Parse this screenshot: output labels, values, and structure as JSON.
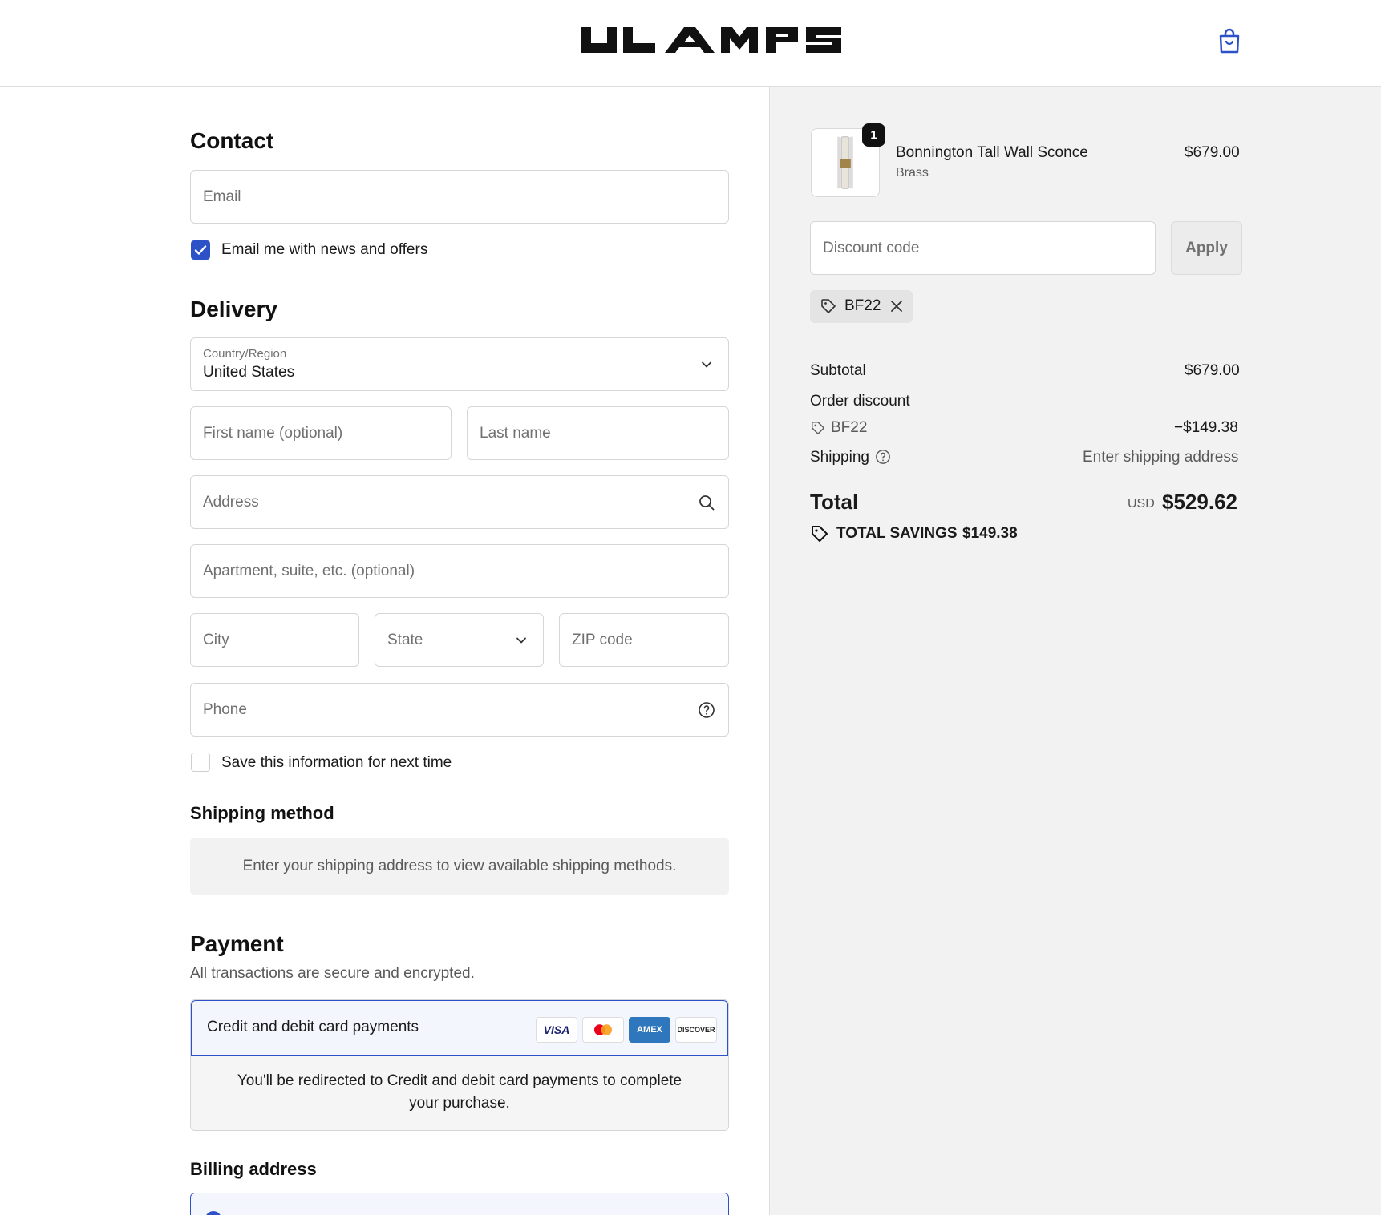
{
  "header": {
    "brand": "ULAMPS",
    "cart_icon": "shopping-bag-icon",
    "accent": "#2d52c8"
  },
  "contact": {
    "title": "Contact",
    "email_placeholder": "Email",
    "newsletter_label": "Email me with news and offers",
    "newsletter_checked": true
  },
  "delivery": {
    "title": "Delivery",
    "country_label": "Country/Region",
    "country_value": "United States",
    "first_name_placeholder": "First name (optional)",
    "last_name_placeholder": "Last name",
    "address_placeholder": "Address",
    "apartment_placeholder": "Apartment, suite, etc. (optional)",
    "city_placeholder": "City",
    "state_placeholder": "State",
    "zip_placeholder": "ZIP code",
    "phone_placeholder": "Phone",
    "save_info_label": "Save this information for next time",
    "save_info_checked": false
  },
  "shipping_method": {
    "title": "Shipping method",
    "notice": "Enter your shipping address to view available shipping methods."
  },
  "payment": {
    "title": "Payment",
    "subtitle": "All transactions are secure and encrypted.",
    "option_label": "Credit and debit card payments",
    "cards": [
      "VISA",
      "Mastercard",
      "AMEX",
      "DISCOVER"
    ],
    "redirect_text": "You'll be redirected to Credit and debit card payments to complete your purchase."
  },
  "billing": {
    "title": "Billing address"
  },
  "summary": {
    "item": {
      "quantity": "1",
      "name": "Bonnington Tall Wall Sconce",
      "variant": "Brass",
      "price": "$679.00"
    },
    "discount_placeholder": "Discount code",
    "apply_label": "Apply",
    "applied_code": "BF22",
    "subtotal_label": "Subtotal",
    "subtotal_value": "$679.00",
    "order_discount_label": "Order discount",
    "discount_code": "BF22",
    "discount_value": "−$149.38",
    "shipping_label": "Shipping",
    "shipping_value": "Enter shipping address",
    "total_label": "Total",
    "currency": "USD",
    "total_value": "$529.62",
    "savings_label": "TOTAL SAVINGS",
    "savings_value": "$149.38"
  }
}
